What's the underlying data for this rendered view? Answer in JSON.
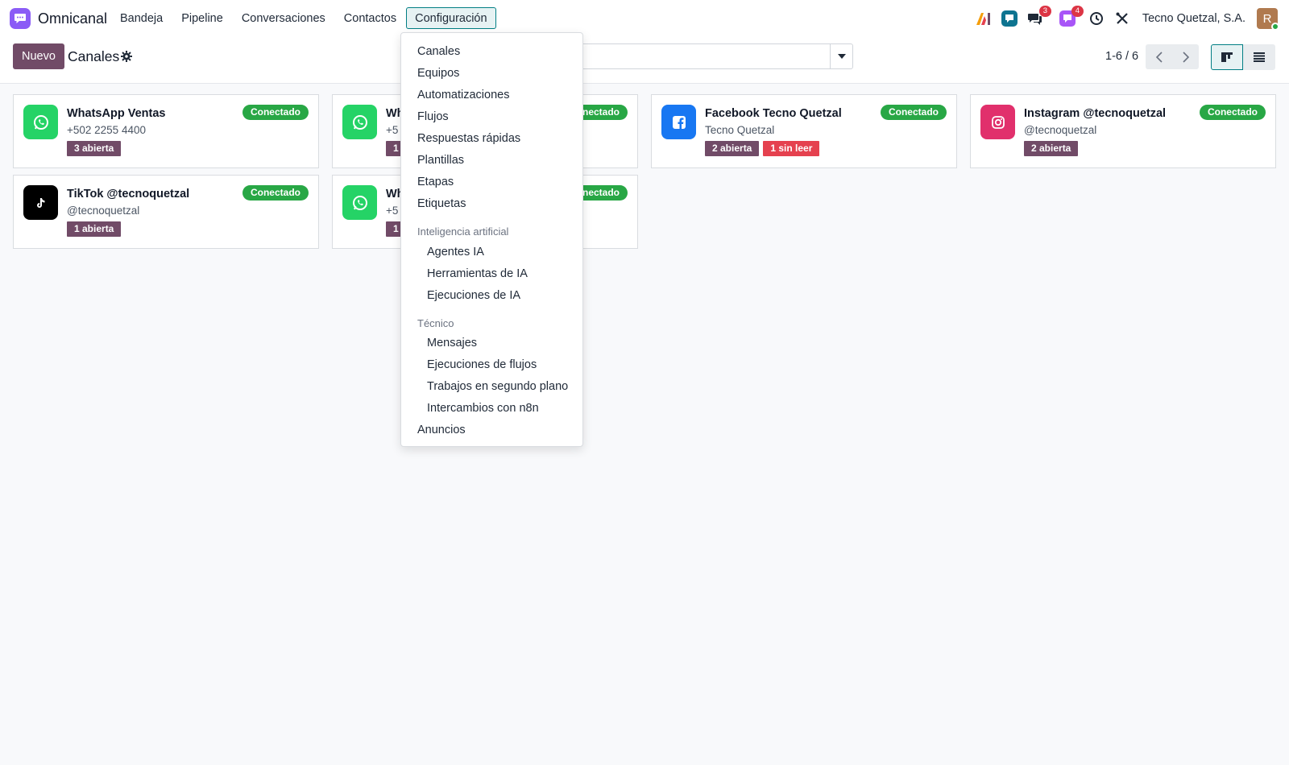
{
  "app": {
    "name": "Omnicanal"
  },
  "nav": {
    "items": [
      "Bandeja",
      "Pipeline",
      "Conversaciones",
      "Contactos",
      "Configuración"
    ],
    "active": "Configuración"
  },
  "systray": {
    "chat_badge": "3",
    "activity_badge": "4",
    "company": "Tecno Quetzal, S.A.",
    "avatar_initial": "R"
  },
  "control_panel": {
    "new_label": "Nuevo",
    "title": "Canales",
    "search_placeholder": "",
    "pager": "1-6 / 6"
  },
  "channels": [
    {
      "name": "WhatsApp Ventas",
      "subtitle": "+502 2255 4400",
      "status": "Conectado",
      "icon": "whatsapp-icon",
      "color": "#25d366",
      "tags": [
        {
          "label": "3 abierta",
          "kind": "open"
        }
      ]
    },
    {
      "name": "Wh",
      "subtitle": "+5",
      "status": "nectado",
      "icon": "whatsapp-icon",
      "color": "#25d366",
      "tags": [
        {
          "label": "1",
          "kind": "open"
        }
      ]
    },
    {
      "name": "Facebook Tecno Quetzal",
      "subtitle": "Tecno Quetzal",
      "status": "Conectado",
      "icon": "facebook-icon",
      "color": "#1877f2",
      "tags": [
        {
          "label": "2 abierta",
          "kind": "open"
        },
        {
          "label": "1 sin leer",
          "kind": "unread"
        }
      ]
    },
    {
      "name": "Instagram @tecnoquetzal",
      "subtitle": "@tecnoquetzal",
      "status": "Conectado",
      "icon": "instagram-icon",
      "color": "#e1306c",
      "tags": [
        {
          "label": "2 abierta",
          "kind": "open"
        }
      ]
    },
    {
      "name": "TikTok @tecnoquetzal",
      "subtitle": "@tecnoquetzal",
      "status": "Conectado",
      "icon": "tiktok-icon",
      "color": "#000000",
      "tags": [
        {
          "label": "1 abierta",
          "kind": "open"
        }
      ]
    },
    {
      "name": "Wh",
      "subtitle": "+5",
      "status": "nectado",
      "icon": "whatsapp-icon",
      "color": "#25d366",
      "tags": [
        {
          "label": "1",
          "kind": "open"
        }
      ]
    }
  ],
  "dropdown": {
    "top_items": [
      "Canales",
      "Equipos",
      "Automatizaciones",
      "Flujos",
      "Respuestas rápidas",
      "Plantillas",
      "Etapas",
      "Etiquetas"
    ],
    "ai_header": "Inteligencia artificial",
    "ai_items": [
      "Agentes IA",
      "Herramientas de IA",
      "Ejecuciones de IA"
    ],
    "tech_header": "Técnico",
    "tech_items": [
      "Mensajes",
      "Ejecuciones de flujos",
      "Trabajos en segundo plano",
      "Intercambios con n8n"
    ],
    "bottom_items": [
      "Anuncios"
    ]
  },
  "colors": {
    "primary": "#714b67",
    "accent": "#017e84",
    "success": "#28a745",
    "danger": "#e5414f"
  }
}
